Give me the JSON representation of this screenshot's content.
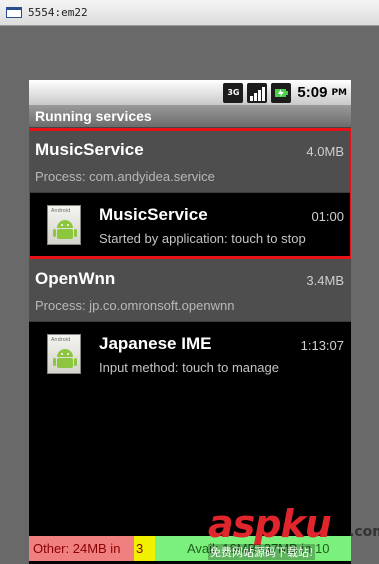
{
  "window": {
    "title": "5554:em22"
  },
  "status_bar": {
    "network": "3G",
    "time": "5:09",
    "ampm": "PM"
  },
  "screen_title": "Running services",
  "groups": [
    {
      "name": "MusicService",
      "size": "4.0MB",
      "process": "Process: com.andyidea.service",
      "services": [
        {
          "name": "MusicService",
          "time": "01:00",
          "description": "Started by application: touch to stop",
          "icon": "android-app-icon"
        }
      ]
    },
    {
      "name": "OpenWnn",
      "size": "3.4MB",
      "process": "Process: jp.co.omronsoft.openwnn",
      "services": [
        {
          "name": "Japanese IME",
          "time": "1:13:07",
          "description": "Input method: touch to manage",
          "icon": "android-app-icon"
        }
      ]
    }
  ],
  "memory_bar": {
    "other": "Other: 24MB in",
    "cached": "3",
    "avail": "Avail: 16MB+37MB in 10",
    "colors": {
      "other": "#f08080",
      "cached": "#f0f000",
      "avail": "#7cf07c"
    }
  },
  "highlight_color": "#e8121a",
  "watermark": {
    "main": "aspku",
    "tld": ".com",
    "sub": "免费网站源码下载站!"
  },
  "icons": {
    "app": "android-app-icon",
    "network": "3g-icon",
    "signal": "signal-icon",
    "battery": "battery-charging-icon"
  }
}
